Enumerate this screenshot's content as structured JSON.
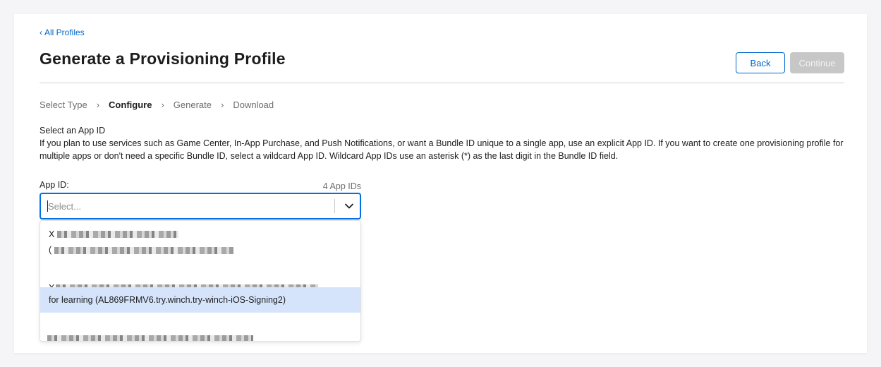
{
  "nav": {
    "back_label": "All Profiles"
  },
  "header": {
    "title": "Generate a Provisioning Profile",
    "back_button": "Back",
    "continue_button": "Continue"
  },
  "steps": [
    {
      "label": "Select Type",
      "active": false
    },
    {
      "label": "Configure",
      "active": true
    },
    {
      "label": "Generate",
      "active": false
    },
    {
      "label": "Download",
      "active": false
    }
  ],
  "section": {
    "title": "Select an App ID",
    "description": "If you plan to use services such as Game Center, In-App Purchase, and Push Notifications, or want a Bundle ID unique to a single app, use an explicit App ID. If you want to create one provisioning profile for multiple apps or don't need a specific Bundle ID, select a wildcard App ID. Wildcard App IDs use an asterisk (*) as the last digit in the Bundle ID field."
  },
  "app_id_field": {
    "label": "App ID:",
    "count": "4 App IDs",
    "placeholder": "Select...",
    "options": [
      {
        "text": "X",
        "second_line": "(",
        "redacted": true
      },
      {
        "text": "X",
        "redacted": true
      },
      {
        "text": "for learning (AL869FRMV6.try.winch.try-winch-iOS-Signing2)",
        "redacted": false,
        "highlighted": true
      },
      {
        "text": "",
        "redacted": true
      }
    ]
  },
  "colors": {
    "accent": "#0066cc",
    "focus_border": "#0071e3",
    "highlight": "#d6e4fb",
    "disabled_button": "#c7c7c7"
  }
}
